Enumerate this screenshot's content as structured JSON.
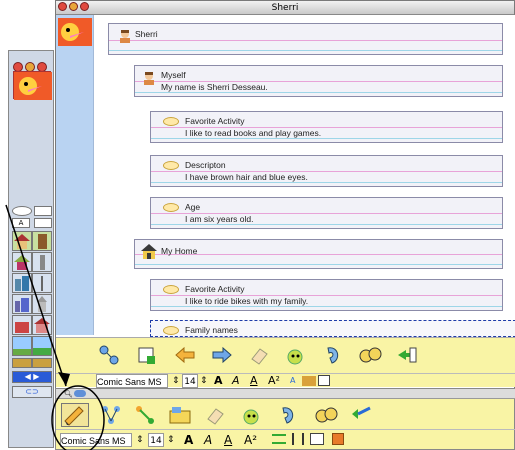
{
  "window": {
    "title": "Sherri"
  },
  "root_node": {
    "label": "Sherri"
  },
  "nodes": [
    {
      "title": "Myself",
      "text": "My name is Sherri Desseau."
    },
    {
      "title": "Favorite Activity",
      "text": "I like to read books and play games."
    },
    {
      "title": "Descripton",
      "text": "I have brown hair and blue eyes."
    },
    {
      "title": "Age",
      "text": "I am six years old."
    },
    {
      "title": "My Home",
      "text": ""
    },
    {
      "title": "Favorite Activity",
      "text": "I like to ride bikes with my family."
    },
    {
      "title": "Family names",
      "text": ""
    }
  ],
  "toolbar1": {
    "font": "Comic Sans MS",
    "size": "14",
    "icons": [
      "map-icon",
      "add-topic-icon",
      "left-arrow-icon",
      "right-arrow-icon",
      "eraser-icon",
      "bug-icon",
      "ear-icon",
      "faces-icon",
      "export-icon"
    ]
  },
  "format1": {
    "bold": "A",
    "italic": "A",
    "underline": "A",
    "superscript": "A²",
    "color": "A"
  },
  "toolbar2": {
    "font": "Comic Sans MS",
    "size": "14",
    "icons": [
      "pencil-icon",
      "diagram-icon",
      "link-icon",
      "folder-icon",
      "eraser-icon",
      "bug-icon",
      "ear-icon",
      "faces-icon",
      "wand-icon"
    ]
  },
  "format2": {
    "bold": "A",
    "italic": "A",
    "underline": "A",
    "superscript": "A²"
  },
  "colors": {
    "yellow_toolbar": "#f9f4a5",
    "blue_strip": "#b9d3f2"
  }
}
